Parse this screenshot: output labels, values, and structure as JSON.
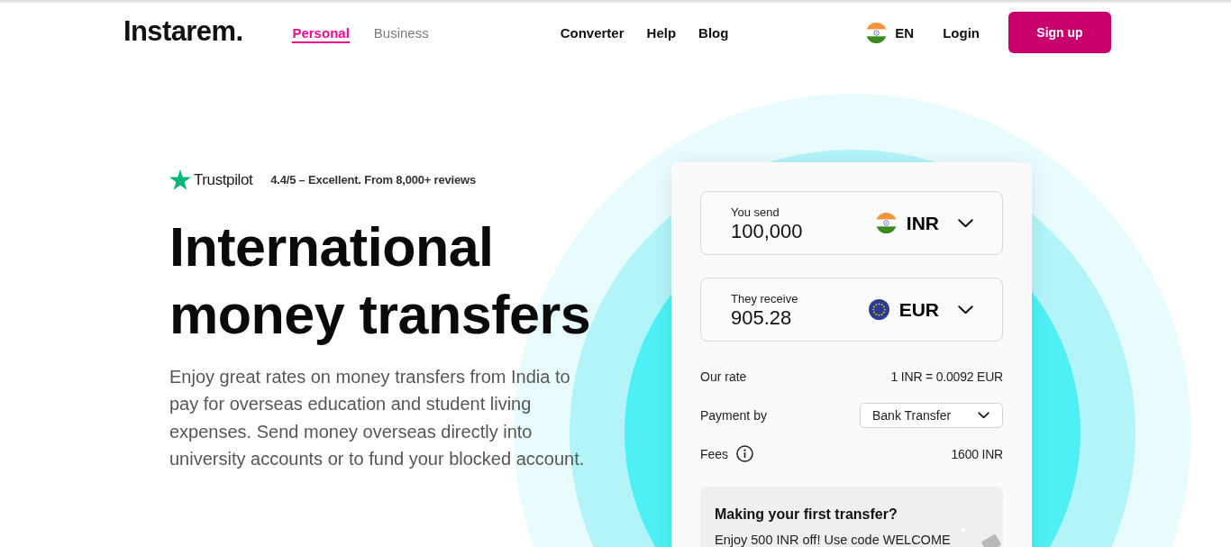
{
  "header": {
    "logo": "Instarem.",
    "tabs": [
      {
        "label": "Personal",
        "selected": true
      },
      {
        "label": "Business",
        "selected": false
      }
    ],
    "nav": [
      "Converter",
      "Help",
      "Blog"
    ],
    "language": "EN",
    "login": "Login",
    "signup": "Sign up"
  },
  "hero": {
    "rating": {
      "brand": "Trustpilot",
      "text": "4.4/5 – Excellent. From 8,000+ reviews"
    },
    "title": "International money transfers",
    "description": "Enjoy great rates on money transfers from India to pay for overseas education and student living expenses. Send money overseas directly into university accounts or to fund your blocked account."
  },
  "converter": {
    "fields": [
      {
        "label": "You send",
        "value": "100,000",
        "currency": "INR"
      },
      {
        "label": "They receive",
        "value": "905.28",
        "currency": "EUR"
      }
    ],
    "rows": [
      {
        "kind": "text",
        "label": "Our rate",
        "value": "1 INR = 0.0092 EUR"
      },
      {
        "kind": "select",
        "label": "Payment by",
        "value": "Bank Transfer"
      },
      {
        "kind": "info",
        "label": "Fees",
        "value": "1600 INR"
      }
    ],
    "promo": {
      "title": "Making your first transfer?",
      "text": "Enjoy 500 INR off! Use code WELCOME"
    }
  }
}
